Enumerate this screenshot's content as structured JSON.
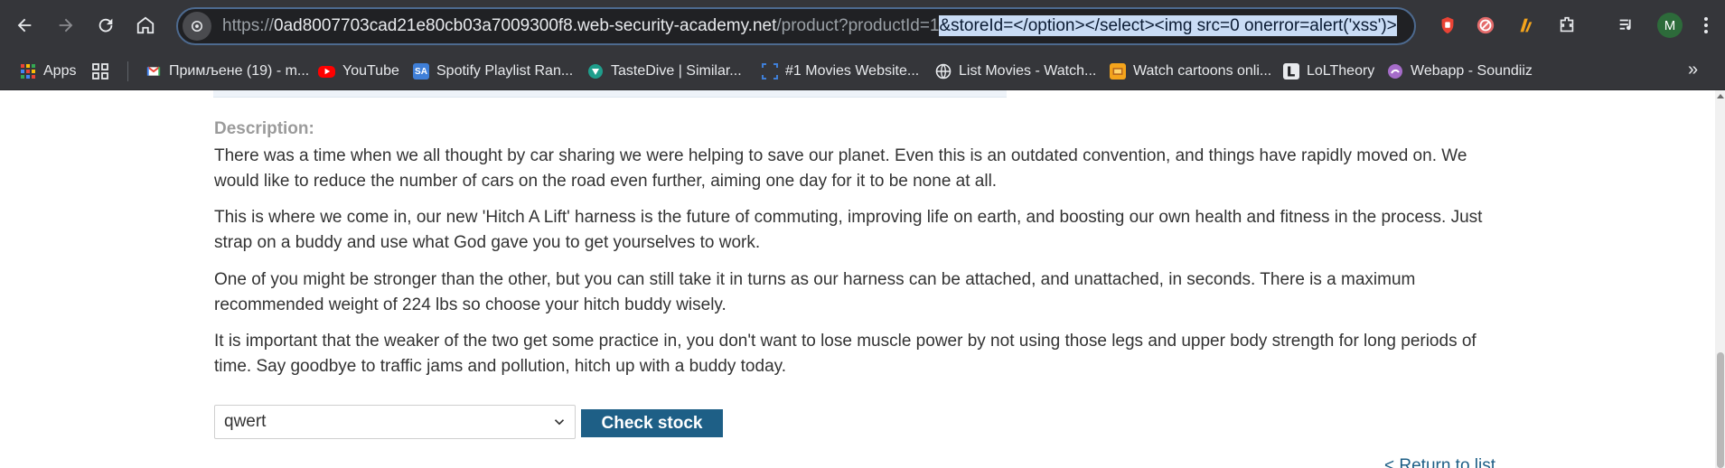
{
  "browser": {
    "url_scheme": "https://",
    "url_host": "0ad8007703cad21e80cb03a7009300f8.web-security-academy.net",
    "url_path": "/product?productId=1",
    "url_selected": "&storeId=</option></select><img src=0 onerror=alert('xss')>",
    "profile_initial": "M",
    "bookmarks": [
      {
        "label": "Apps",
        "icon": "apps-grid-icon",
        "color": "#ea4335"
      },
      {
        "label": "",
        "icon": "tab-groups-icon",
        "color": "#e8eaed"
      },
      {
        "label": "Примљене (19) - m...",
        "icon": "gmail-icon",
        "color": "#ea4335"
      },
      {
        "label": "YouTube",
        "icon": "youtube-icon",
        "color": "#ff0000"
      },
      {
        "label": "Spotify Playlist Ran...",
        "icon": "spotify-tool-icon",
        "color": "#3f7fd8"
      },
      {
        "label": "TasteDive | Similar...",
        "icon": "tastedive-icon",
        "color": "#1f9e8c"
      },
      {
        "label": "#1 Movies Website...",
        "icon": "movies-icon",
        "color": "#3f7fd8"
      },
      {
        "label": "List Movies - Watch...",
        "icon": "globe-icon",
        "color": "#e8eaed"
      },
      {
        "label": "Watch cartoons onli...",
        "icon": "cartoons-icon",
        "color": "#f4a41c"
      },
      {
        "label": "LoLTheory",
        "icon": "loltheory-icon",
        "color": "#e8eaed"
      },
      {
        "label": "Webapp - Soundiiz",
        "icon": "soundiiz-icon",
        "color": "#a56cc9"
      }
    ]
  },
  "page": {
    "description_label": "Description:",
    "paragraphs": [
      "There was a time when we all thought by car sharing we were helping to save our planet. Even this is an outdated convention, and things have rapidly moved on. We would like to reduce the number of cars on the road even further, aiming one day for it to be none at all.",
      "This is where we come in, our new 'Hitch A Lift' harness is the future of commuting, improving life on earth, and boosting our own health and fitness in the process. Just strap on a buddy and use what God gave you to get yourselves to work.",
      "One of you might be stronger than the other, but you can still take it in turns as our harness can be attached, and unattached, in seconds. There is a maximum recommended weight of 224 lbs so choose your hitch buddy wisely.",
      "It is important that the weaker of the two get some practice in, you don't want to lose muscle power by not using those legs and upper body strength for long periods of time. Say goodbye to traffic jams and pollution, hitch up with a buddy today."
    ],
    "store_select_value": "qwert",
    "check_stock_label": "Check stock",
    "return_link": "< Return to list"
  },
  "colors": {
    "accent": "#1e5f86",
    "chrome_bg": "#35363a",
    "url_selection": "#c9dcf5"
  }
}
